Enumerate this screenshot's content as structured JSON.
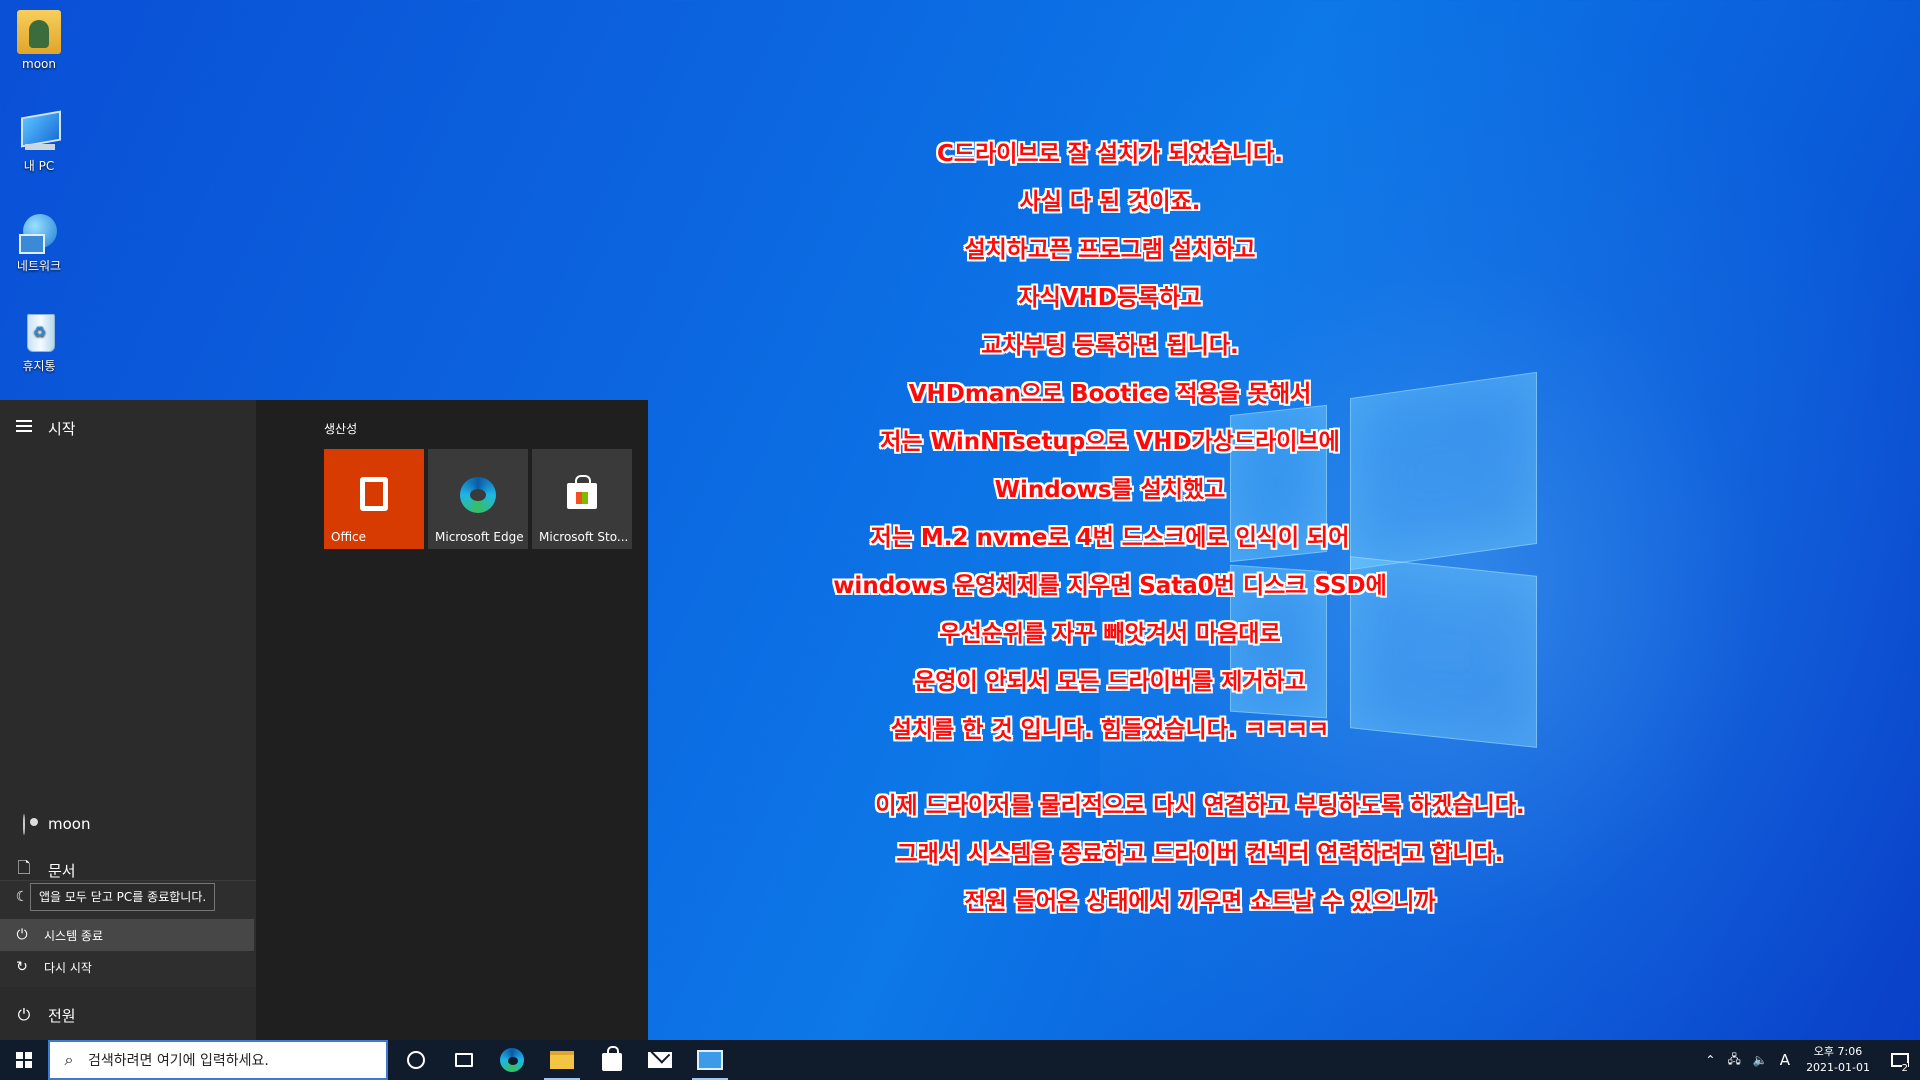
{
  "desktop": {
    "icons": [
      {
        "label": "moon",
        "icon": "user-folder-icon"
      },
      {
        "label": "내 PC",
        "icon": "computer-icon"
      },
      {
        "label": "네트워크",
        "icon": "network-icon"
      },
      {
        "label": "휴지통",
        "icon": "recycle-bin-icon"
      }
    ],
    "notes": [
      "C드라이브로 잘 설치가 되었습니다.",
      "사실  다 된  것이죠.",
      "설치하고픈 프로그램 설치하고",
      "자식VHD등록하고",
      "교차부팅 등록하면 됩니다.",
      "VHDman으로 Bootice 적용을 못해서",
      "저는 WinNTsetup으로 VHD가상드라이브에",
      "Windows를 설치했고",
      "저는 M.2 nvme로 4번 드스크에로  인식이 되어",
      "windows 운영체제를 지우면  Sata0번 디스크 SSD에",
      "우선순위를 자꾸 빼앗겨서 마음대로",
      "운영이 안되서  모든 드라이버를 제거하고",
      "설치를 한 것 입니다. 힘들었습니다. ㅋㅋㅋㅋ"
    ],
    "notes2": [
      "이제 드라이저를 물리적으로 다시 연결하고 부팅하도록 하겠습니다.",
      "그래서 시스템을 종료하고  드라이버  컨넥터 연력하려고 합니다.",
      "전원 들어온 상태에서 끼우면 쇼트날 수 있으니까"
    ]
  },
  "start_menu": {
    "title": "시작",
    "user": "moon",
    "documents": "문서",
    "power": "전원",
    "tooltip": "앱을 모두 닫고 PC를 종료합니다.",
    "power_options": [
      {
        "label": "시스템 종료",
        "icon": "power-icon"
      },
      {
        "label": "다시 시작",
        "icon": "restart-icon"
      }
    ],
    "group_title": "생산성",
    "tiles": [
      {
        "label": "Office",
        "icon": "office-icon",
        "color": "#d83b01"
      },
      {
        "label": "Microsoft Edge",
        "icon": "edge-icon",
        "color": "#3a3a3a"
      },
      {
        "label": "Microsoft Sto...",
        "icon": "store-icon",
        "color": "#3a3a3a"
      }
    ]
  },
  "taskbar": {
    "search_placeholder": "검색하려면 여기에 입력하세요.",
    "apps": [
      "cortana-icon",
      "task-view-icon",
      "edge-icon",
      "file-explorer-icon",
      "store-icon",
      "mail-icon",
      "app-icon"
    ],
    "tray": {
      "ime": "A",
      "time": "오후 7:06",
      "date": "2021-01-01",
      "notifications": "2"
    }
  }
}
